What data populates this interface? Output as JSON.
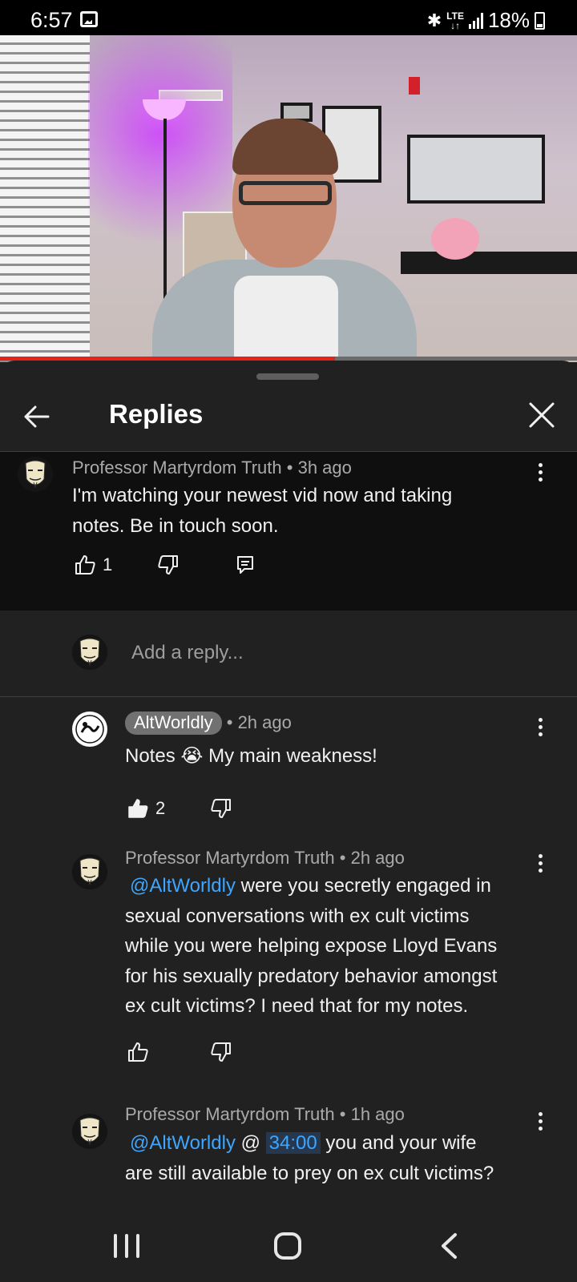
{
  "status_bar": {
    "time": "6:57",
    "network": "LTE",
    "battery": "18%"
  },
  "video": {
    "progress": 0.58
  },
  "sheet": {
    "title": "Replies"
  },
  "parent_comment": {
    "author": "Professor Martyrdom Truth",
    "age": "3h ago",
    "text_lines": [
      "I'm watching your newest vid now and taking",
      "notes. Be in touch soon."
    ],
    "likes": "1"
  },
  "add_reply": {
    "placeholder": "Add a reply..."
  },
  "replies": [
    {
      "author": "AltWorldly",
      "age": "2h ago",
      "text_before": "Notes ",
      "emoji": "😭",
      "text_after": " My main weakness!",
      "likes": "2"
    },
    {
      "author": "Professor Martyrdom Truth",
      "age": "2h ago",
      "mention": "@AltWorldly",
      "line1_rest": " were you secretly engaged in",
      "lines": [
        "sexual conversations with ex cult victims",
        "while you were helping expose Lloyd Evans",
        "for his sexually predatory behavior amongst",
        "ex cult victims? I need that for my notes."
      ]
    },
    {
      "author": "Professor Martyrdom Truth",
      "age": "1h ago",
      "mention": "@AltWorldly",
      "at": " @ ",
      "timestamp": "34:00",
      "line1_rest": " you and your wife",
      "line2": "are still available to prey on ex cult victims?"
    }
  ],
  "meta_sep": " • ",
  "colors": {
    "sheet_bg": "#212121",
    "highlight_bg": "#0f0f0f",
    "link": "#3ea6ff",
    "progress": "#e62117"
  },
  "icons": [
    "back-arrow-icon",
    "close-icon",
    "more-vert-icon",
    "thumb-up-icon",
    "thumb-down-icon",
    "reply-icon"
  ]
}
